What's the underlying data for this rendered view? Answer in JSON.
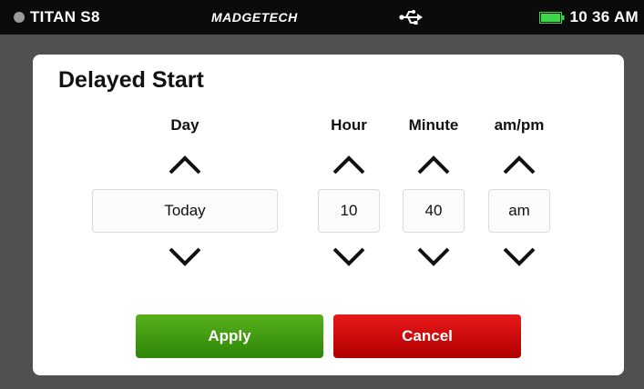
{
  "statusbar": {
    "device_name": "TITAN S8",
    "brand": "MADGETECH",
    "usb_icon": "usb-icon",
    "battery_icon": "battery-icon",
    "battery_color": "#3cd64a",
    "time": "10 36 AM"
  },
  "dialog": {
    "title": "Delayed Start",
    "columns": [
      {
        "key": "day",
        "label": "Day",
        "value": "Today"
      },
      {
        "key": "hour",
        "label": "Hour",
        "value": "10"
      },
      {
        "key": "minute",
        "label": "Minute",
        "value": "40"
      },
      {
        "key": "ampm",
        "label": "am/pm",
        "value": "am"
      }
    ],
    "apply_label": "Apply",
    "cancel_label": "Cancel",
    "apply_color": "#3f9a0f",
    "cancel_color": "#d00000"
  }
}
